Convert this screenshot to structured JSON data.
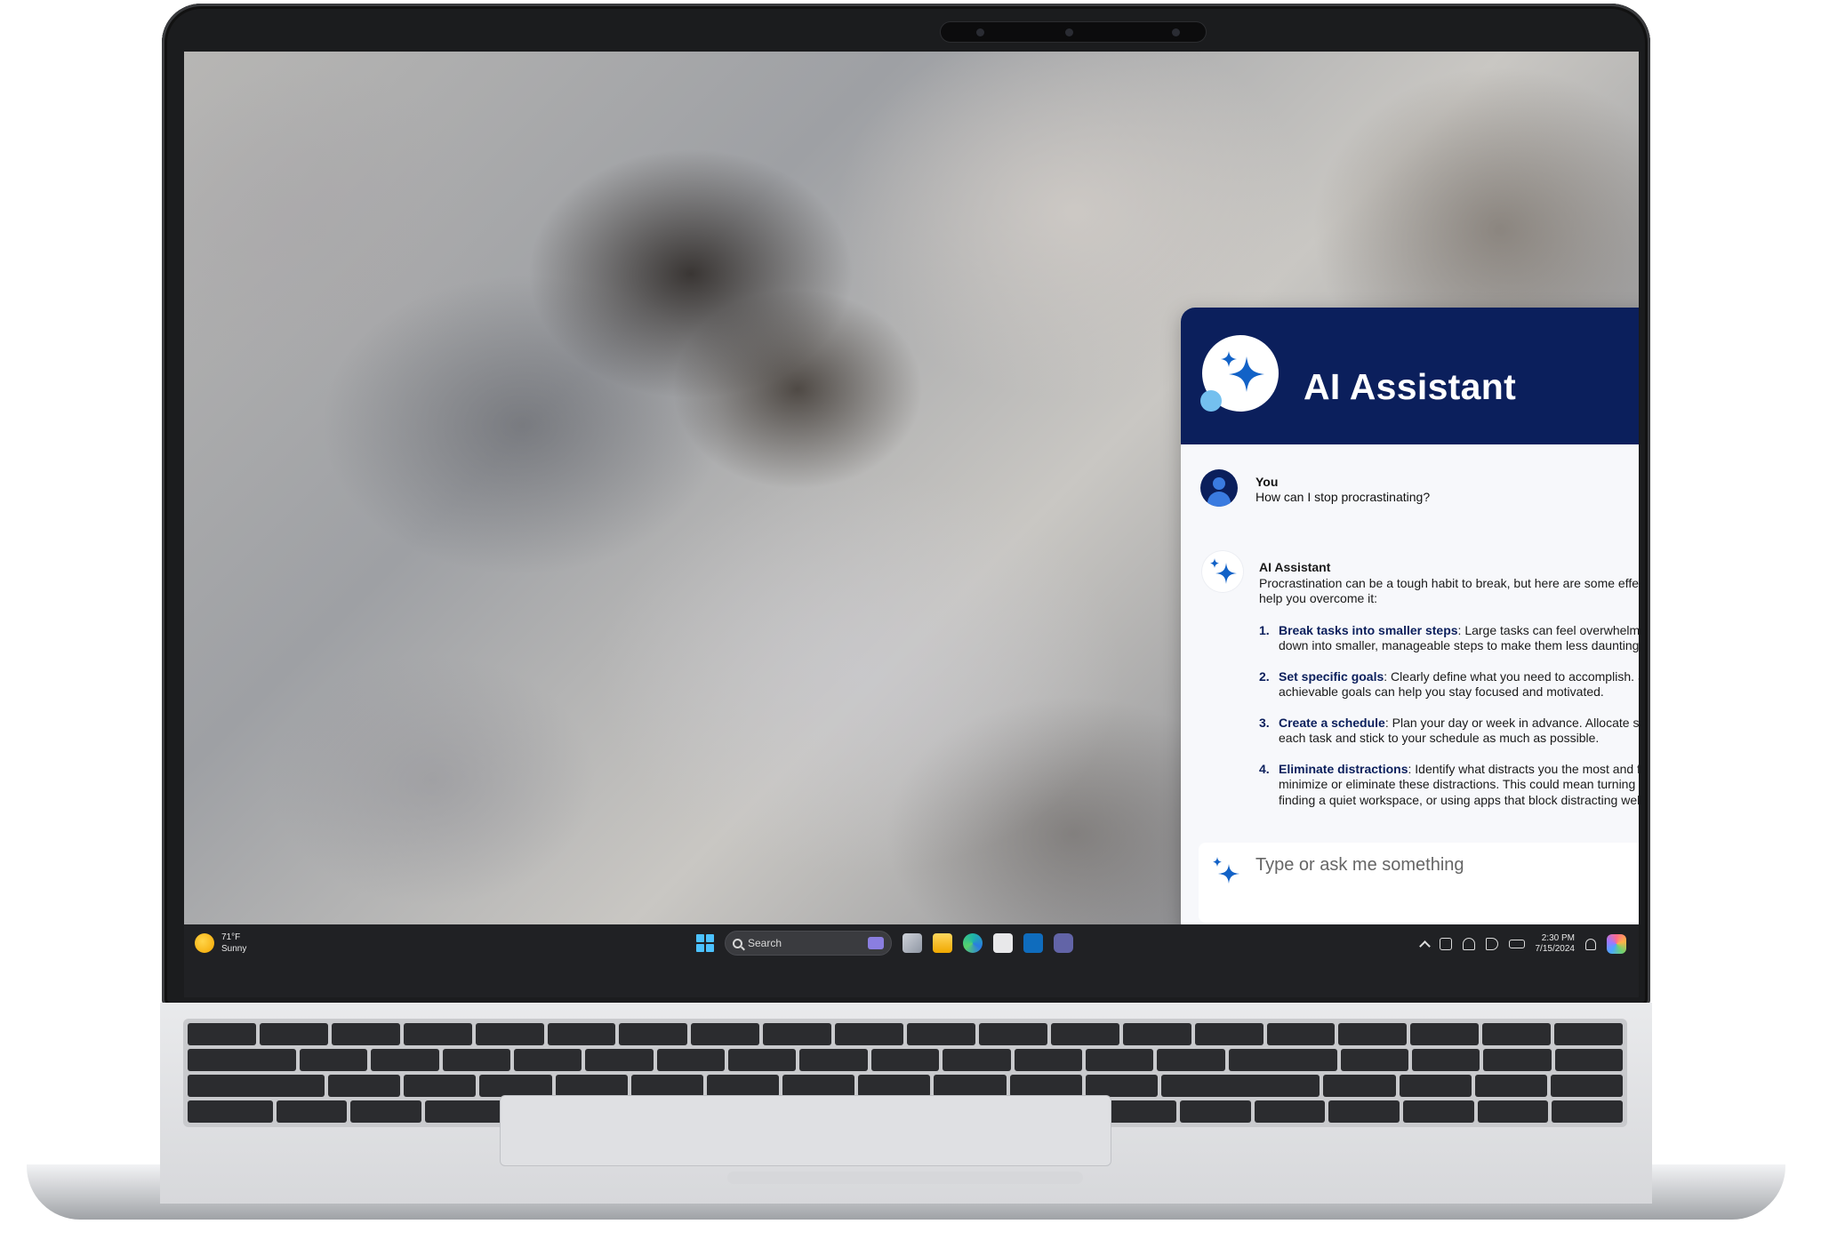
{
  "taskbar": {
    "weather_temp": "71°F",
    "weather_condition": "Sunny",
    "search_placeholder": "Search",
    "time": "2:30 PM",
    "date": "7/15/2024"
  },
  "assistant": {
    "title": "AI Assistant",
    "user_message": {
      "author": "You",
      "text": "How can I stop procrastinating?"
    },
    "ai_message": {
      "author": "AI Assistant",
      "intro": "Procrastination can be a tough habit to break, but here are some effective strategies to help you overcome it:",
      "items": [
        {
          "number": "1.",
          "term": "Break tasks into smaller steps",
          "text": ": Large tasks can feel overwhelming. Break them down into smaller, manageable steps to make them less daunting."
        },
        {
          "number": "2.",
          "term": "Set specific goals",
          "text": ": Clearly define what you need to accomplish. Setting specific, achievable goals can help you stay focused and motivated."
        },
        {
          "number": "3.",
          "term": "Create a schedule",
          "text": ": Plan your day or week in advance. Allocate specific times for each task and stick to your schedule as much as possible."
        },
        {
          "number": "4.",
          "term": "Eliminate distractions",
          "text": ": Identify what distracts you the most and find ways to minimize or eliminate these distractions. This could mean turning off notific-ations, finding a quiet workspace, or using apps that block distracting websites."
        }
      ]
    },
    "input_placeholder": "Type or ask me something"
  },
  "colors": {
    "header": "#0b1f5c",
    "accent_blue": "#1f5fbf",
    "taskbar": "#202124"
  },
  "icons": {
    "logo": "sparkle-icon",
    "menu": "hamburger-menu-icon",
    "send": "send-icon",
    "user": "user-avatar-icon"
  }
}
